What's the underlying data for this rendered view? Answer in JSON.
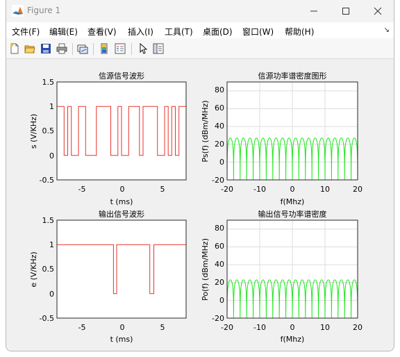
{
  "window": {
    "title": "Figure 1",
    "icon": "matlab-icon",
    "controls": [
      "minimize-icon",
      "maximize-icon",
      "close-icon"
    ]
  },
  "menu": [
    {
      "label": "文件(F)"
    },
    {
      "label": "编辑(E)"
    },
    {
      "label": "查看(V)"
    },
    {
      "label": "插入(I)"
    },
    {
      "label": "工具(T)"
    },
    {
      "label": "桌面(D)"
    },
    {
      "label": "窗口(W)"
    },
    {
      "label": "帮助(H)"
    }
  ],
  "menu_corner_icon": "dock-arrow-icon",
  "toolbar": [
    "new-figure-icon",
    "open-file-icon",
    "save-icon",
    "print-icon",
    "link-plot-icon",
    "colorbar-icon",
    "legend-icon",
    "pointer-icon",
    "property-editor-icon"
  ],
  "colors": {
    "signal": "#e8322a",
    "spectrum": "#19e619",
    "grid": "#dedede",
    "axes_bg": "#ffffff"
  },
  "chart_data": [
    {
      "type": "line",
      "title": "信源信号波形",
      "xlabel": "t (ms)",
      "ylabel": "s  (V/KHz)",
      "xlim": [
        -8,
        8
      ],
      "ylim": [
        -0.5,
        1.5
      ],
      "xticks": [
        "-5",
        "0",
        "5"
      ],
      "yticks": [
        "-0.5",
        "0",
        "0.5",
        "1",
        "1.5"
      ],
      "grid": false,
      "series": [
        {
          "values": [
            1,
            1,
            0,
            1,
            0,
            0,
            1,
            1,
            0,
            0,
            0,
            1,
            1,
            1,
            1,
            0,
            0,
            1,
            0,
            0,
            1,
            1,
            1,
            0,
            1,
            1,
            1,
            1,
            0,
            0,
            1,
            0,
            1,
            0,
            1,
            1
          ]
        }
      ]
    },
    {
      "type": "line",
      "title": "信源功率谱密度图形",
      "xlabel": "f(Mhz)",
      "ylabel": "Ps(f) (dBm/MHz)",
      "xlim": [
        -20,
        20
      ],
      "ylim": [
        -20,
        90
      ],
      "xticks": [
        "-20",
        "-10",
        "0",
        "10",
        "20"
      ],
      "yticks": [
        "-20",
        "0",
        "20",
        "40",
        "60",
        "80"
      ],
      "grid": true,
      "lobe_peak": 27,
      "null_spacing_mhz": 2
    },
    {
      "type": "line",
      "title": "输出信号波形",
      "xlabel": "t (ms)",
      "ylabel": "e  (V/KHz)",
      "xlim": [
        -8,
        8
      ],
      "ylim": [
        -0.5,
        1.5
      ],
      "xticks": [
        "-5",
        "0",
        "5"
      ],
      "yticks": [
        "-0.5",
        "0",
        "0.5",
        "1",
        "1.5"
      ],
      "grid": false,
      "series": [
        {
          "points": [
            [
              -8,
              1
            ],
            [
              -1.0,
              1
            ],
            [
              -1.0,
              0
            ],
            [
              -0.6,
              0
            ],
            [
              -0.6,
              1
            ],
            [
              3.5,
              1
            ],
            [
              3.5,
              0
            ],
            [
              4.0,
              0
            ],
            [
              4.0,
              1
            ],
            [
              8,
              1
            ]
          ]
        }
      ]
    },
    {
      "type": "line",
      "title": "输出信号功率谱密度",
      "xlabel": "f(Mhz)",
      "ylabel": "Po(f) (dBm/MHz)",
      "xlim": [
        -20,
        20
      ],
      "ylim": [
        -20,
        90
      ],
      "xticks": [
        "-20",
        "-10",
        "0",
        "10",
        "20"
      ],
      "yticks": [
        "-20",
        "0",
        "20",
        "40",
        "60",
        "80"
      ],
      "grid": true,
      "lobe_peak": 23,
      "null_spacing_mhz": 2
    }
  ]
}
